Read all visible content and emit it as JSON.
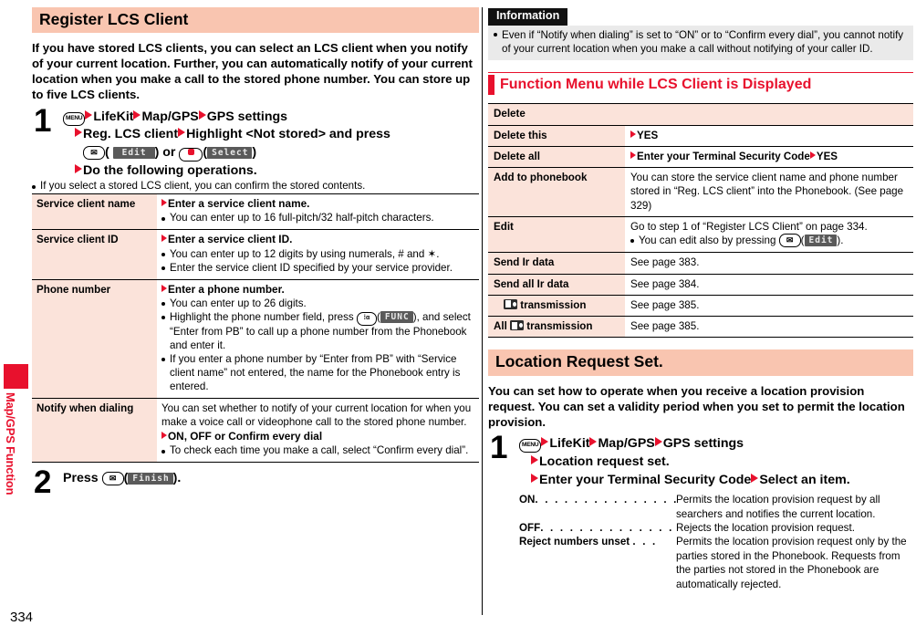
{
  "page": {
    "number": "334",
    "side_tab_label": "Map/GPS Function",
    "accent_red": "#e8112d",
    "heading_bg": "#f9c5b0",
    "table_label_bg": "#fbe3da"
  },
  "left": {
    "chapter_title": "Register LCS Client",
    "lead": "If you have stored LCS clients, you can select an LCS client when you notify of your current location. Further, you can automatically notify of your current location when you make a call to the stored phone number. You can store up to five LCS clients.",
    "step1": {
      "number": "1",
      "line1_a": "LifeKit",
      "line1_b": "Map/GPS",
      "line1_c": "GPS settings",
      "line2_a": "Reg. LCS client",
      "line2_b": "Highlight <Not stored> and press",
      "line3_softkey1": "Edit",
      "line3_or": ") or ",
      "line3_softkey2": "Select",
      "line4": "Do the following operations.",
      "note": "If you select a stored LCS client, you can confirm the stored contents."
    },
    "table": [
      {
        "label": "Service client name",
        "head": "Enter a service client name.",
        "bullets": [
          "You can enter up to 16 full-pitch/32 half-pitch characters."
        ]
      },
      {
        "label": "Service client ID",
        "head": "Enter a service client ID.",
        "bullets": [
          "You can enter up to 12 digits by using numerals, # and ✶.",
          "Enter the service client ID specified by your service provider."
        ]
      },
      {
        "label": "Phone number",
        "head": "Enter a phone number.",
        "bullets": [
          "You can enter up to 26 digits.",
          "Highlight the phone number field, press |ia|(|FUNC|), and select “Enter from PB” to call up a phone number from the Phonebook and enter it.",
          "If you enter a phone number by “Enter from PB” with “Service client name” not entered, the name for the Phonebook entry is entered."
        ]
      },
      {
        "label": "Notify when dialing",
        "plain": "You can set whether to notify of your current location for when you make a voice call or videophone call to the stored phone number.",
        "arrow_line": "ON, OFF or Confirm every dial",
        "bullets": [
          "To check each time you make a call, select “Confirm every dial”."
        ]
      }
    ],
    "step2": {
      "number": "2",
      "press_label": "Press",
      "softkey": "Finish",
      "tail": ")."
    }
  },
  "right": {
    "information": {
      "tag": "Information",
      "bullets": [
        "Even if “Notify when dialing” is set to “ON” or to “Confirm every dial”, you cannot notify of your current location when you make a call without notifying of your caller ID."
      ]
    },
    "function_menu": {
      "title": "Function Menu while LCS Client is Displayed",
      "group_label": "Delete",
      "subrows": [
        {
          "label": "Delete this",
          "value": "YES"
        },
        {
          "label": "Delete all",
          "value_a": "Enter your Terminal Security Code",
          "value_b": "YES"
        }
      ],
      "rows": [
        {
          "label": "Add to phonebook",
          "value": "You can store the service client name and phone number stored in “Reg. LCS client” into the Phonebook. (See page 329)"
        },
        {
          "label": "Edit",
          "value": "Go to step 1 of “Register LCS Client” on page 334.",
          "bullet_pre": "You can edit also by pressing ",
          "bullet_softkey": "Edit",
          "bullet_post": ")."
        },
        {
          "label": "Send Ir data",
          "value": "See page 383."
        },
        {
          "label": "Send all Ir data",
          "value": "See page 384."
        },
        {
          "label_icon_before": "",
          "label_icon": "ic-card-icon",
          "label_after": "transmission",
          "value": "See page 385."
        },
        {
          "label_icon_before": "All",
          "label_icon": "ic-card-icon",
          "label_after": "transmission",
          "value": "See page 385."
        }
      ]
    },
    "location_request": {
      "title": "Location Request Set.",
      "lead": "You can set how to operate when you receive a location provision request. You can set a validity period when you set to permit the location provision.",
      "step1": {
        "number": "1",
        "line1_a": "LifeKit",
        "line1_b": "Map/GPS",
        "line1_c": "GPS settings",
        "line2": "Location request set.",
        "line3_a": "Enter your Terminal Security Code",
        "line3_b": "Select an item."
      },
      "options": [
        {
          "term": "ON",
          "dots": ". . . . . . . . . . . . . . . . . .",
          "desc": "Permits the location provision request by all searchers and notifies the current location."
        },
        {
          "term": "OFF",
          "dots": ". . . . . . . . . . . . . . . . .",
          "desc": "Rejects the location provision request."
        },
        {
          "term": "Reject numbers unset",
          "dots": ". . .",
          "desc": "Permits the location provision request only by the parties stored in the Phonebook. Requests from the parties not stored in the Phonebook are automatically rejected."
        }
      ]
    }
  }
}
